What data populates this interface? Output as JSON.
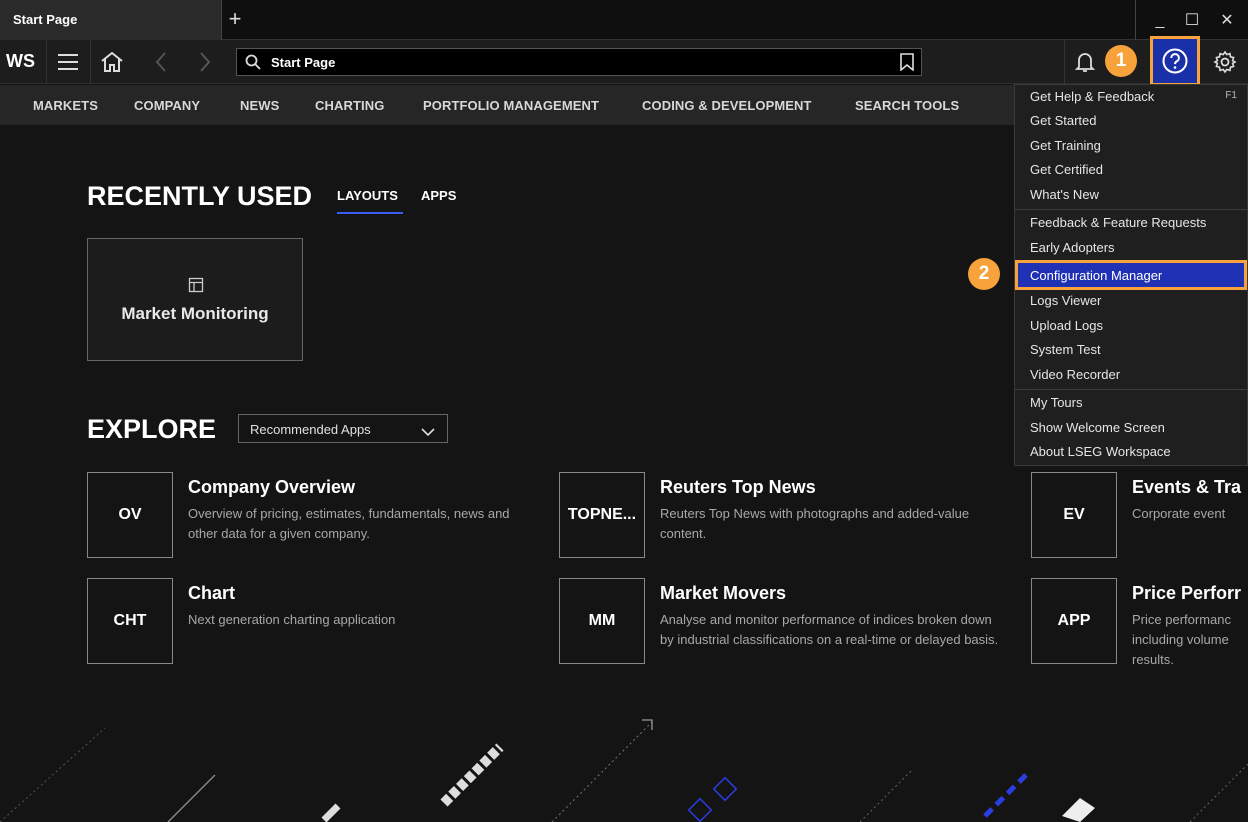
{
  "tab": {
    "title": "Start Page",
    "new_tab": "+"
  },
  "window": {
    "minimize": "_",
    "maximize": "☐",
    "close": "✕"
  },
  "toolbar": {
    "logo": "WS",
    "search_value": "Start Page"
  },
  "callouts": {
    "one": "1",
    "two": "2"
  },
  "nav": {
    "items": [
      "MARKETS",
      "COMPANY",
      "NEWS",
      "CHARTING",
      "PORTFOLIO MANAGEMENT",
      "CODING & DEVELOPMENT",
      "SEARCH TOOLS"
    ]
  },
  "recent": {
    "heading": "RECENTLY USED",
    "tabs": [
      "LAYOUTS",
      "APPS"
    ],
    "card_label": "Market Monitoring"
  },
  "explore": {
    "heading": "EXPLORE",
    "dropdown_value": "Recommended Apps",
    "apps": [
      {
        "code": "OV",
        "title": "Company Overview",
        "desc": "Overview of pricing, estimates, fundamentals, news and other data for a given company."
      },
      {
        "code": "TOPNE...",
        "title": "Reuters Top News",
        "desc": "Reuters Top News with photographs and added-value content."
      },
      {
        "code": "EV",
        "title": "Events & Tra",
        "desc": "Corporate event"
      },
      {
        "code": "CHT",
        "title": "Chart",
        "desc": "Next generation charting application"
      },
      {
        "code": "MM",
        "title": "Market Movers",
        "desc": "Analyse and monitor performance of indices broken down by industrial classifications on a real-time or delayed basis."
      },
      {
        "code": "APP",
        "title": "Price Perforr",
        "desc": "Price performanc including volume results."
      }
    ]
  },
  "help_menu": {
    "shortcut": "F1",
    "items": [
      "Get Help & Feedback",
      "Get Started",
      "Get Training",
      "Get Certified",
      "What's New",
      "Feedback & Feature Requests",
      "Early Adopters",
      "Configuration Manager",
      "Logs Viewer",
      "Upload Logs",
      "System Test",
      "Video Recorder",
      "My Tours",
      "Show Welcome Screen",
      "About LSEG Workspace"
    ]
  },
  "colors": {
    "accent": "#f7a23b",
    "selection": "#1f31b5",
    "underline": "#3a5cf2"
  }
}
